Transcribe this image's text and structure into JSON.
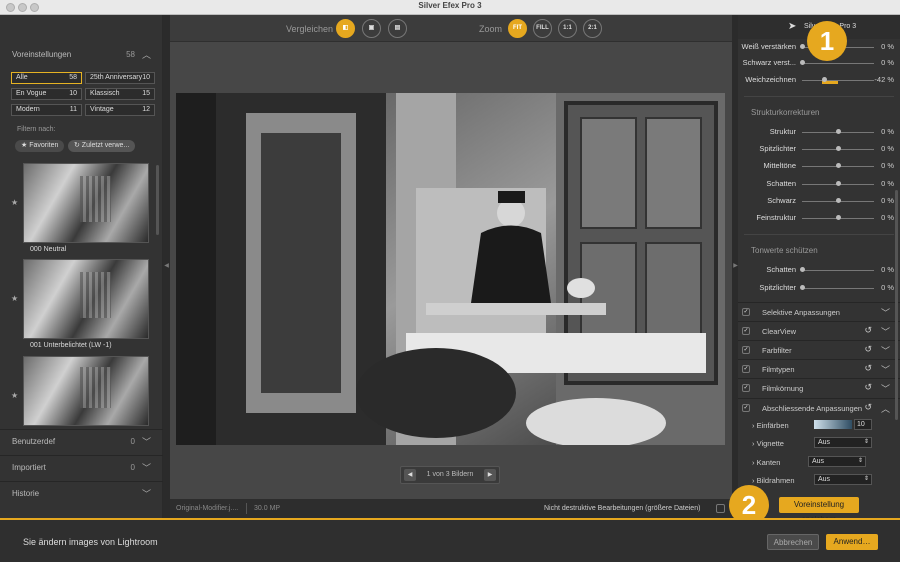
{
  "window": {
    "title": "Silver Efex Pro 3"
  },
  "left_panel": {
    "presets_header": {
      "label": "Voreinstellungen",
      "count": "58"
    },
    "categories": [
      {
        "label": "Alle",
        "count": "58"
      },
      {
        "label": "25th Anniversary",
        "count": "10"
      },
      {
        "label": "En Vogue",
        "count": "10"
      },
      {
        "label": "Klassisch",
        "count": "15"
      },
      {
        "label": "Modern",
        "count": "11"
      },
      {
        "label": "Vintage",
        "count": "12"
      }
    ],
    "filter_label": "Filtern nach:",
    "filter_chips": [
      "★ Favoriten",
      "↻ Zuletzt verwe..."
    ],
    "presets": [
      {
        "label": "000 Neutral"
      },
      {
        "label": "001 Unterbelichtet (LW -1)"
      },
      {
        "label": ""
      }
    ],
    "sections": [
      {
        "label": "Benutzerdef",
        "count": "0"
      },
      {
        "label": "Importiert",
        "count": "0"
      },
      {
        "label": "Historie",
        "count": ""
      }
    ]
  },
  "center": {
    "compare_label": "Vergleichen",
    "zoom_label": "Zoom",
    "zoom_buttons": [
      "FIT",
      "FILL",
      "1:1",
      "2:1"
    ],
    "pager_text": "1 von 3 Bildern",
    "status_file": "Original-Modifier.j....",
    "status_mp": "30.0 MP",
    "nondestructive_label": "Nicht destruktive Bearbeitungen (größere Dateien)"
  },
  "right_panel": {
    "logo_text": "Silver Efex Pro 3",
    "top_sliders": [
      {
        "label": "Weiß verstärken",
        "value": "0 %",
        "level": 0
      },
      {
        "label": "Schwarz verst...",
        "value": "0 %",
        "level": 0
      },
      {
        "label": "Weichzeichnen",
        "value": "-42 %",
        "level": -42
      }
    ],
    "structure_title": "Strukturkorrekturen",
    "structure_sliders": [
      {
        "label": "Struktur",
        "value": "0 %"
      },
      {
        "label": "Spitzlichter",
        "value": "0 %"
      },
      {
        "label": "Mitteltöne",
        "value": "0 %"
      },
      {
        "label": "Schatten",
        "value": "0 %"
      },
      {
        "label": "Schwarz",
        "value": "0 %"
      },
      {
        "label": "Feinstruktur",
        "value": "0 %"
      }
    ],
    "tone_title": "Tonwerte schützen",
    "tone_sliders": [
      {
        "label": "Schatten",
        "value": "0 %"
      },
      {
        "label": "Spitzlichter",
        "value": "0 %"
      }
    ],
    "adjustments": [
      {
        "label": "Selektive Anpassungen",
        "reset": false,
        "open": false
      },
      {
        "label": "ClearView",
        "reset": true,
        "open": false
      },
      {
        "label": "Farbfilter",
        "reset": true,
        "open": false
      },
      {
        "label": "Filmtypen",
        "reset": true,
        "open": false
      },
      {
        "label": "Filmkörnung",
        "reset": true,
        "open": false
      },
      {
        "label": "Abschliessende Anpassungen",
        "reset": true,
        "open": true
      }
    ],
    "finishing": [
      {
        "label": "Einfärben",
        "value": "10"
      },
      {
        "label": "Vignette",
        "value": "Aus"
      },
      {
        "label": "Kanten",
        "value": "Aus"
      },
      {
        "label": "Bildrahmen",
        "value": "Aus"
      }
    ],
    "save_preset_label": "Voreinstellung speichern"
  },
  "badges": [
    "1",
    "2"
  ],
  "footer": {
    "message": "Sie ändern images von Lightroom",
    "cancel_label": "Abbrechen",
    "apply_label": "Anwend…"
  },
  "colors": {
    "accent": "#e6a81f"
  }
}
